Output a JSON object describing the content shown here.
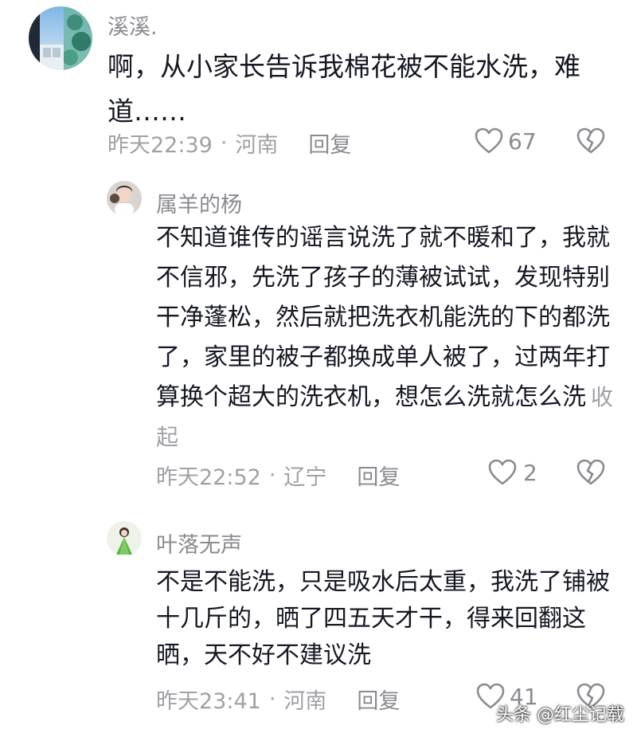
{
  "comments": [
    {
      "username": "溪溪.",
      "text": "啊，从小家长告诉我棉花被不能水洗，难道……",
      "time": "昨天22:39",
      "location": "河南",
      "reply_label": "回复",
      "likes": "67",
      "is_reply": false
    },
    {
      "username": "属羊的杨",
      "text": "不知道谁传的谣言说洗了就不暖和了，我就不信邪，先洗了孩子的薄被试试，发现特别干净蓬松，然后就把洗衣机能洗的下的都洗了，家里的被子都换成单人被了，过两年打算换个超大的洗衣机，想怎么洗就怎么洗",
      "collapse_label": "收起",
      "time": "昨天22:52",
      "location": "辽宁",
      "reply_label": "回复",
      "likes": "2",
      "is_reply": true
    },
    {
      "username": "叶落无声",
      "text": "不是不能洗，只是吸水后太重，我洗了铺被十几斤的，晒了四五天才干，得来回翻这晒，天不好不建议洗",
      "time": "昨天23:41",
      "location": "河南",
      "reply_label": "回复",
      "likes": "41",
      "is_reply": true
    }
  ],
  "separator": "·",
  "watermark": "头条 @红尘记载",
  "colors": {
    "text": "#161823",
    "muted": "#a0a1a6",
    "icon": "#8a8b91"
  }
}
